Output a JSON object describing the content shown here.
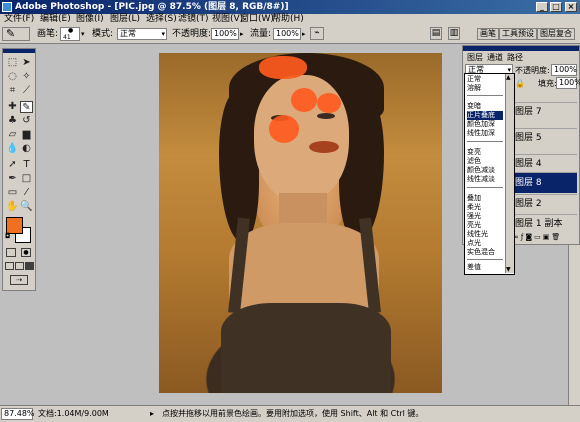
{
  "window": {
    "title": "Adobe Photoshop - [PIC.jpg @ 87.5% (图层 8, RGB/8#)]",
    "min": "_",
    "max": "□",
    "close": "×"
  },
  "menu": [
    "文件(F)",
    "编辑(E)",
    "图像(I)",
    "图层(L)",
    "选择(S)",
    "滤镜(T)",
    "视图(V)",
    "窗口(W)",
    "帮助(H)"
  ],
  "options": {
    "brush_label": "画笔:",
    "brush_size": "41",
    "mode_label": "模式:",
    "mode_value": "正常",
    "opacity_label": "不透明度:",
    "opacity_value": "100%",
    "flow_label": "流量:",
    "flow_value": "100%",
    "tabs": [
      "画笔",
      "工具预设",
      "图层复合"
    ]
  },
  "layers_panel": {
    "tabs": [
      "图层",
      "通道",
      "路径"
    ],
    "blend_value": "正常",
    "opacity_label": "不透明度:",
    "opacity_value": "100%",
    "fill_label": "填充:",
    "fill_value": "100%",
    "layers": [
      "图层 7",
      "图层 5",
      "图层 4",
      "图层 3",
      "图层 8",
      "图层 2",
      "图层 1 副本"
    ],
    "selected_layer": "图层 8"
  },
  "blend_dropdown": {
    "groups": [
      [
        "正常",
        "溶解"
      ],
      [
        "变暗",
        "正片叠底",
        "颜色加深",
        "线性加深"
      ],
      [
        "变亮",
        "滤色",
        "颜色减淡",
        "线性减淡"
      ],
      [
        "叠加",
        "柔光",
        "强光",
        "亮光",
        "线性光",
        "点光",
        "实色混合"
      ],
      [
        "差值"
      ]
    ],
    "highlighted": "正片叠底"
  },
  "status": {
    "zoom": "87.48%",
    "doc": "文档:1.04M/9.00M",
    "hint": "点按并拖移以用前景色绘画。要用附加选项，使用 Shift、Alt 和 Ctrl 键。"
  },
  "colors": {
    "foreground": "#f07020",
    "background": "#ffffff",
    "blush": "#ff5a1e",
    "selection": "#0a246a"
  }
}
